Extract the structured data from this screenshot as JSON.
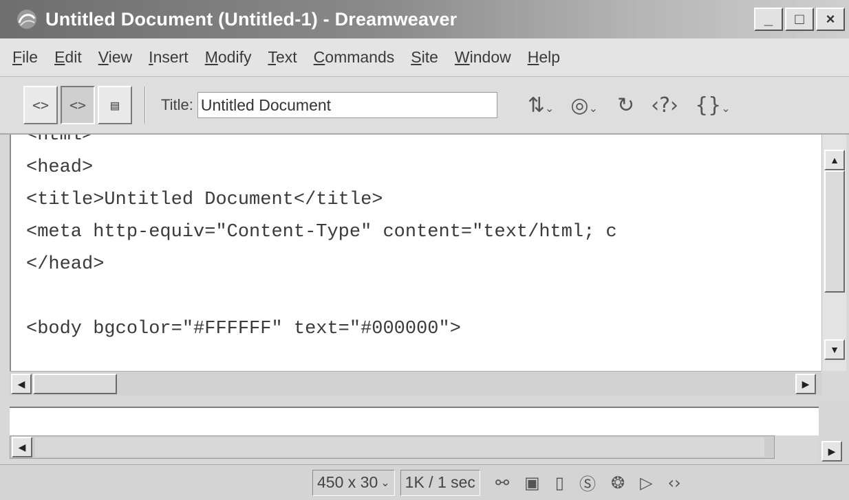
{
  "window": {
    "title": "Untitled Document (Untitled-1) - Dreamweaver",
    "buttons": {
      "minimize": "_",
      "maximize": "□",
      "close": "×"
    }
  },
  "menu": {
    "items": [
      {
        "mnemonic": "F",
        "rest": "ile"
      },
      {
        "mnemonic": "E",
        "rest": "dit"
      },
      {
        "mnemonic": "V",
        "rest": "iew"
      },
      {
        "mnemonic": "I",
        "rest": "nsert"
      },
      {
        "mnemonic": "M",
        "rest": "odify"
      },
      {
        "mnemonic": "T",
        "rest": "ext"
      },
      {
        "mnemonic": "C",
        "rest": "ommands"
      },
      {
        "mnemonic": "S",
        "rest": "ite"
      },
      {
        "mnemonic": "W",
        "rest": "indow"
      },
      {
        "mnemonic": "H",
        "rest": "elp"
      }
    ]
  },
  "toolbar": {
    "title_label": "Title:",
    "title_value": "Untitled Document",
    "view_buttons": [
      "<>",
      "<>",
      "▤"
    ],
    "icons": [
      "file-management-icon",
      "preview-browser-icon",
      "refresh-icon",
      "reference-icon",
      "code-navigation-icon"
    ]
  },
  "code": {
    "lines": [
      "<html>",
      "<head>",
      "<title>Untitled Document</title>",
      "<meta http-equiv=\"Content-Type\" content=\"text/html; c",
      "</head>",
      "",
      "<body bgcolor=\"#FFFFFF\" text=\"#000000\">"
    ]
  },
  "status": {
    "window_size": "450 x 30",
    "download": "1K / 1 sec"
  }
}
